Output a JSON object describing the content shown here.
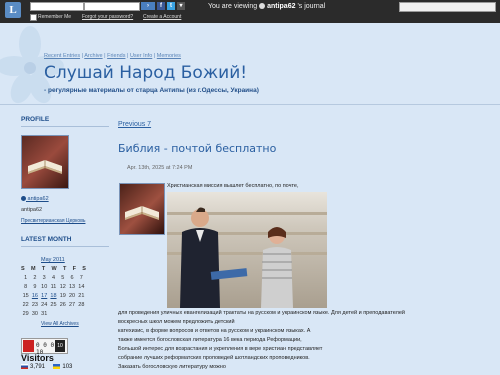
{
  "topbar": {
    "remember_label": "Remember Me",
    "forgot_label": "Forgot your password?",
    "create_label": "Create a Account",
    "login_label": "Login",
    "viewing_prefix": "You are viewing",
    "viewing_user": "antipa62",
    "viewing_suffix": "'s journal"
  },
  "header": {
    "nav": [
      "Recent Entries",
      "Archive",
      "Friends",
      "User Info",
      "Memories"
    ],
    "title": "Слушай Народ Божий!",
    "subtitle": "- регулярные материалы от старца Антипы (из г.Одессы, Украина)"
  },
  "sidebar": {
    "profile_heading": "PROFILE",
    "username": "antipa62",
    "name": "antipa62",
    "profile_link": "Пресвитерианская Церковь",
    "latest_heading": "LATEST MONTH",
    "calendar": {
      "month": "May 2011",
      "days_header": [
        "S",
        "M",
        "T",
        "W",
        "T",
        "F",
        "S"
      ],
      "rows": [
        [
          "1",
          "2",
          "3",
          "4",
          "5",
          "6",
          "7"
        ],
        [
          "8",
          "9",
          "10",
          "11",
          "12",
          "13",
          "14"
        ],
        [
          "15",
          "16",
          "17",
          "18",
          "19",
          "20",
          "21"
        ],
        [
          "22",
          "23",
          "24",
          "25",
          "26",
          "27",
          "28"
        ],
        [
          "29",
          "30",
          "31",
          "",
          "",
          "",
          ""
        ]
      ],
      "archives_label": "View All Archives"
    },
    "counter": {
      "value": "0 0 0 0 10",
      "flag_label": "10"
    },
    "visitors_title": "Visitors",
    "visitors_count_ru": "3,791",
    "visitors_count_ua": "103"
  },
  "post": {
    "prev_label": "Previous 7",
    "title": "Библия - почтой бесплатно",
    "date": "Apr. 13th, 2025 at 7:24 PM",
    "intro": "Христианская миссия вышлет бесплатно, по почте,",
    "lines": [
      "для проведения уличных евангелизаций трактаты на русском и украинском языке. Для детей и преподавателей",
      "воскресных школ можем предложить детский",
      "катехизис, в форме вопросов и ответов на русском и украинском языках. А",
      "также имеется богословская литература 16 века периода Реформации,",
      "Большой интерес для возрастания и укрепления в вере христиан представляет",
      "собрание лучших реформатских проповедей шотландских проповедников.",
      "Заказать богословскую литературу можно"
    ]
  }
}
